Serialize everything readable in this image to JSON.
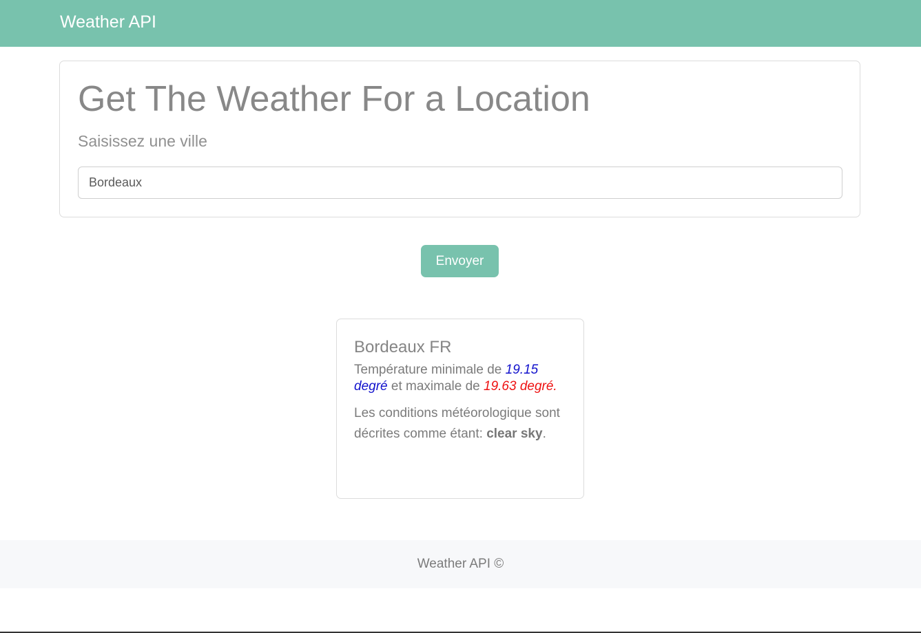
{
  "navbar": {
    "brand": "Weather API"
  },
  "form": {
    "title": "Get The Weather For a Location",
    "subtitle": "Saisissez une ville",
    "city_value": "Bordeaux",
    "submit_label": "Envoyer"
  },
  "result": {
    "location": "Bordeaux FR",
    "temp_prefix": "Température minimale de",
    "temp_min": "19.15 degré",
    "temp_middle": "et maximale de",
    "temp_max": "19.63 degré.",
    "cond_prefix": "Les conditions météorologique sont décrites comme étant:",
    "cond_value": "clear sky",
    "cond_suffix": ".",
    "colors": {
      "min": "#1111cc",
      "max": "#ee1111"
    }
  },
  "footer": {
    "text": "Weather API ©"
  },
  "theme": {
    "accent": "#78c2ad",
    "footer_bg": "#f7f8fa"
  }
}
